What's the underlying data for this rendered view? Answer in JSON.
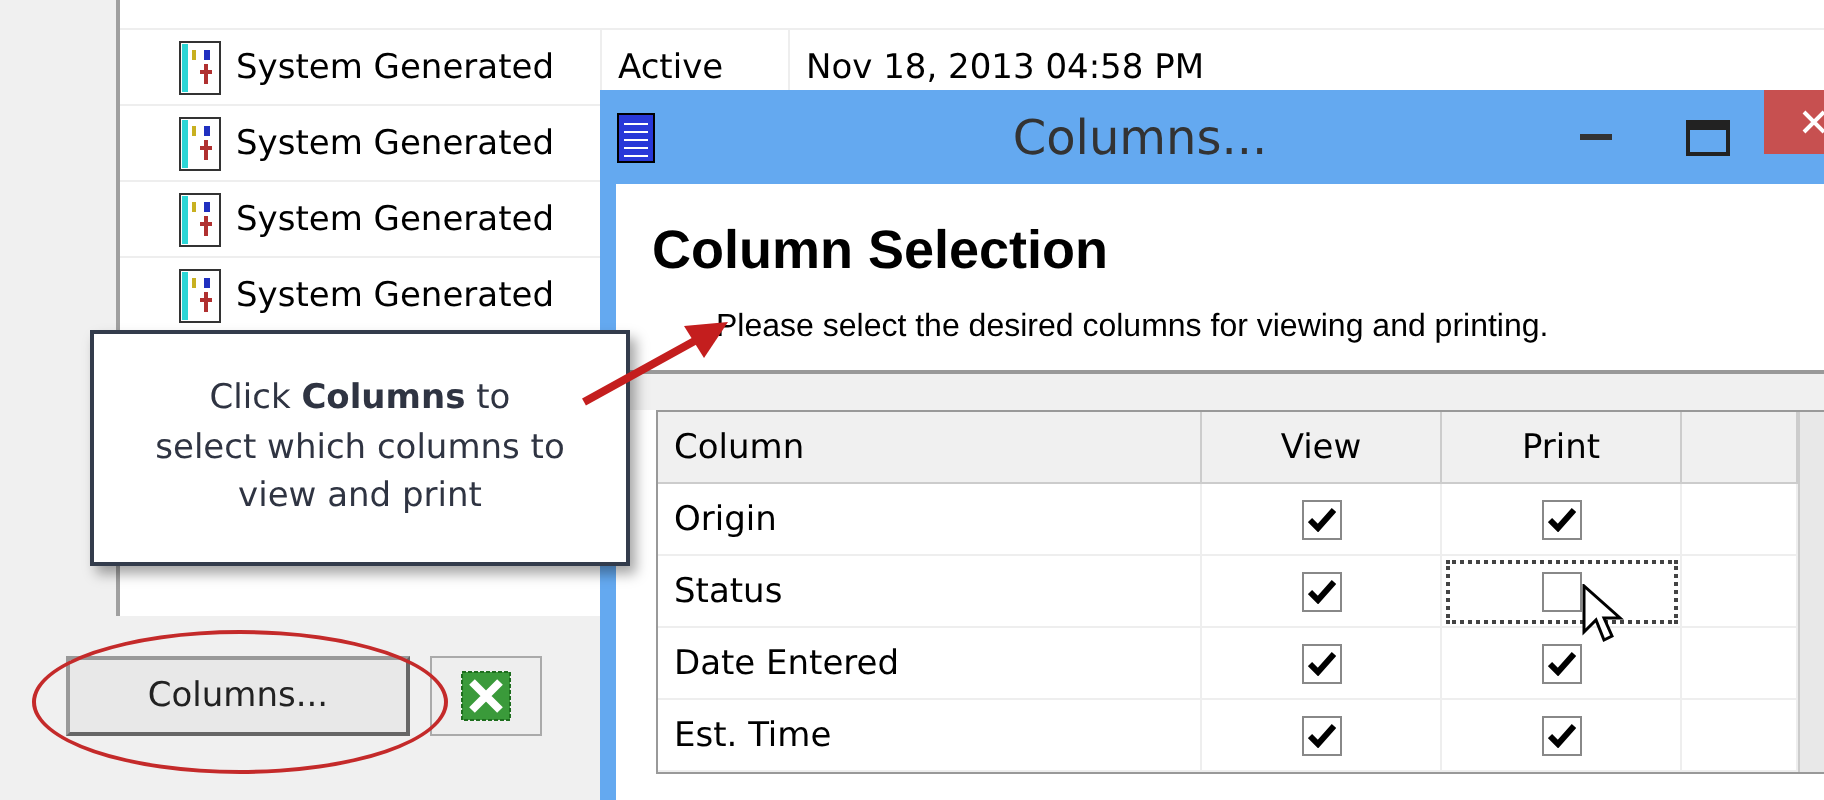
{
  "background_list": {
    "rows": [
      {
        "name": "System Generated",
        "status": "Active",
        "date": "Nov 18, 2013 04:58 PM"
      },
      {
        "name": "System Generated"
      },
      {
        "name": "System Generated"
      },
      {
        "name": "System Generated"
      }
    ]
  },
  "columns_button": {
    "label": "Columns..."
  },
  "dialog": {
    "title": "Columns...",
    "heading": "Column Selection",
    "instructions": "Please select the desired columns for viewing and printing.",
    "grid": {
      "headers": [
        "Column",
        "View",
        "Print"
      ],
      "rows": [
        {
          "column": "Origin",
          "view": true,
          "print": true,
          "focused": false
        },
        {
          "column": "Status",
          "view": true,
          "print": false,
          "focused": true
        },
        {
          "column": "Date Entered",
          "view": true,
          "print": true,
          "focused": false
        },
        {
          "column": "Est. Time",
          "view": true,
          "print": true,
          "focused": false
        }
      ]
    }
  },
  "callout": {
    "text": "Click **Columns** to select which columns to view and print"
  }
}
